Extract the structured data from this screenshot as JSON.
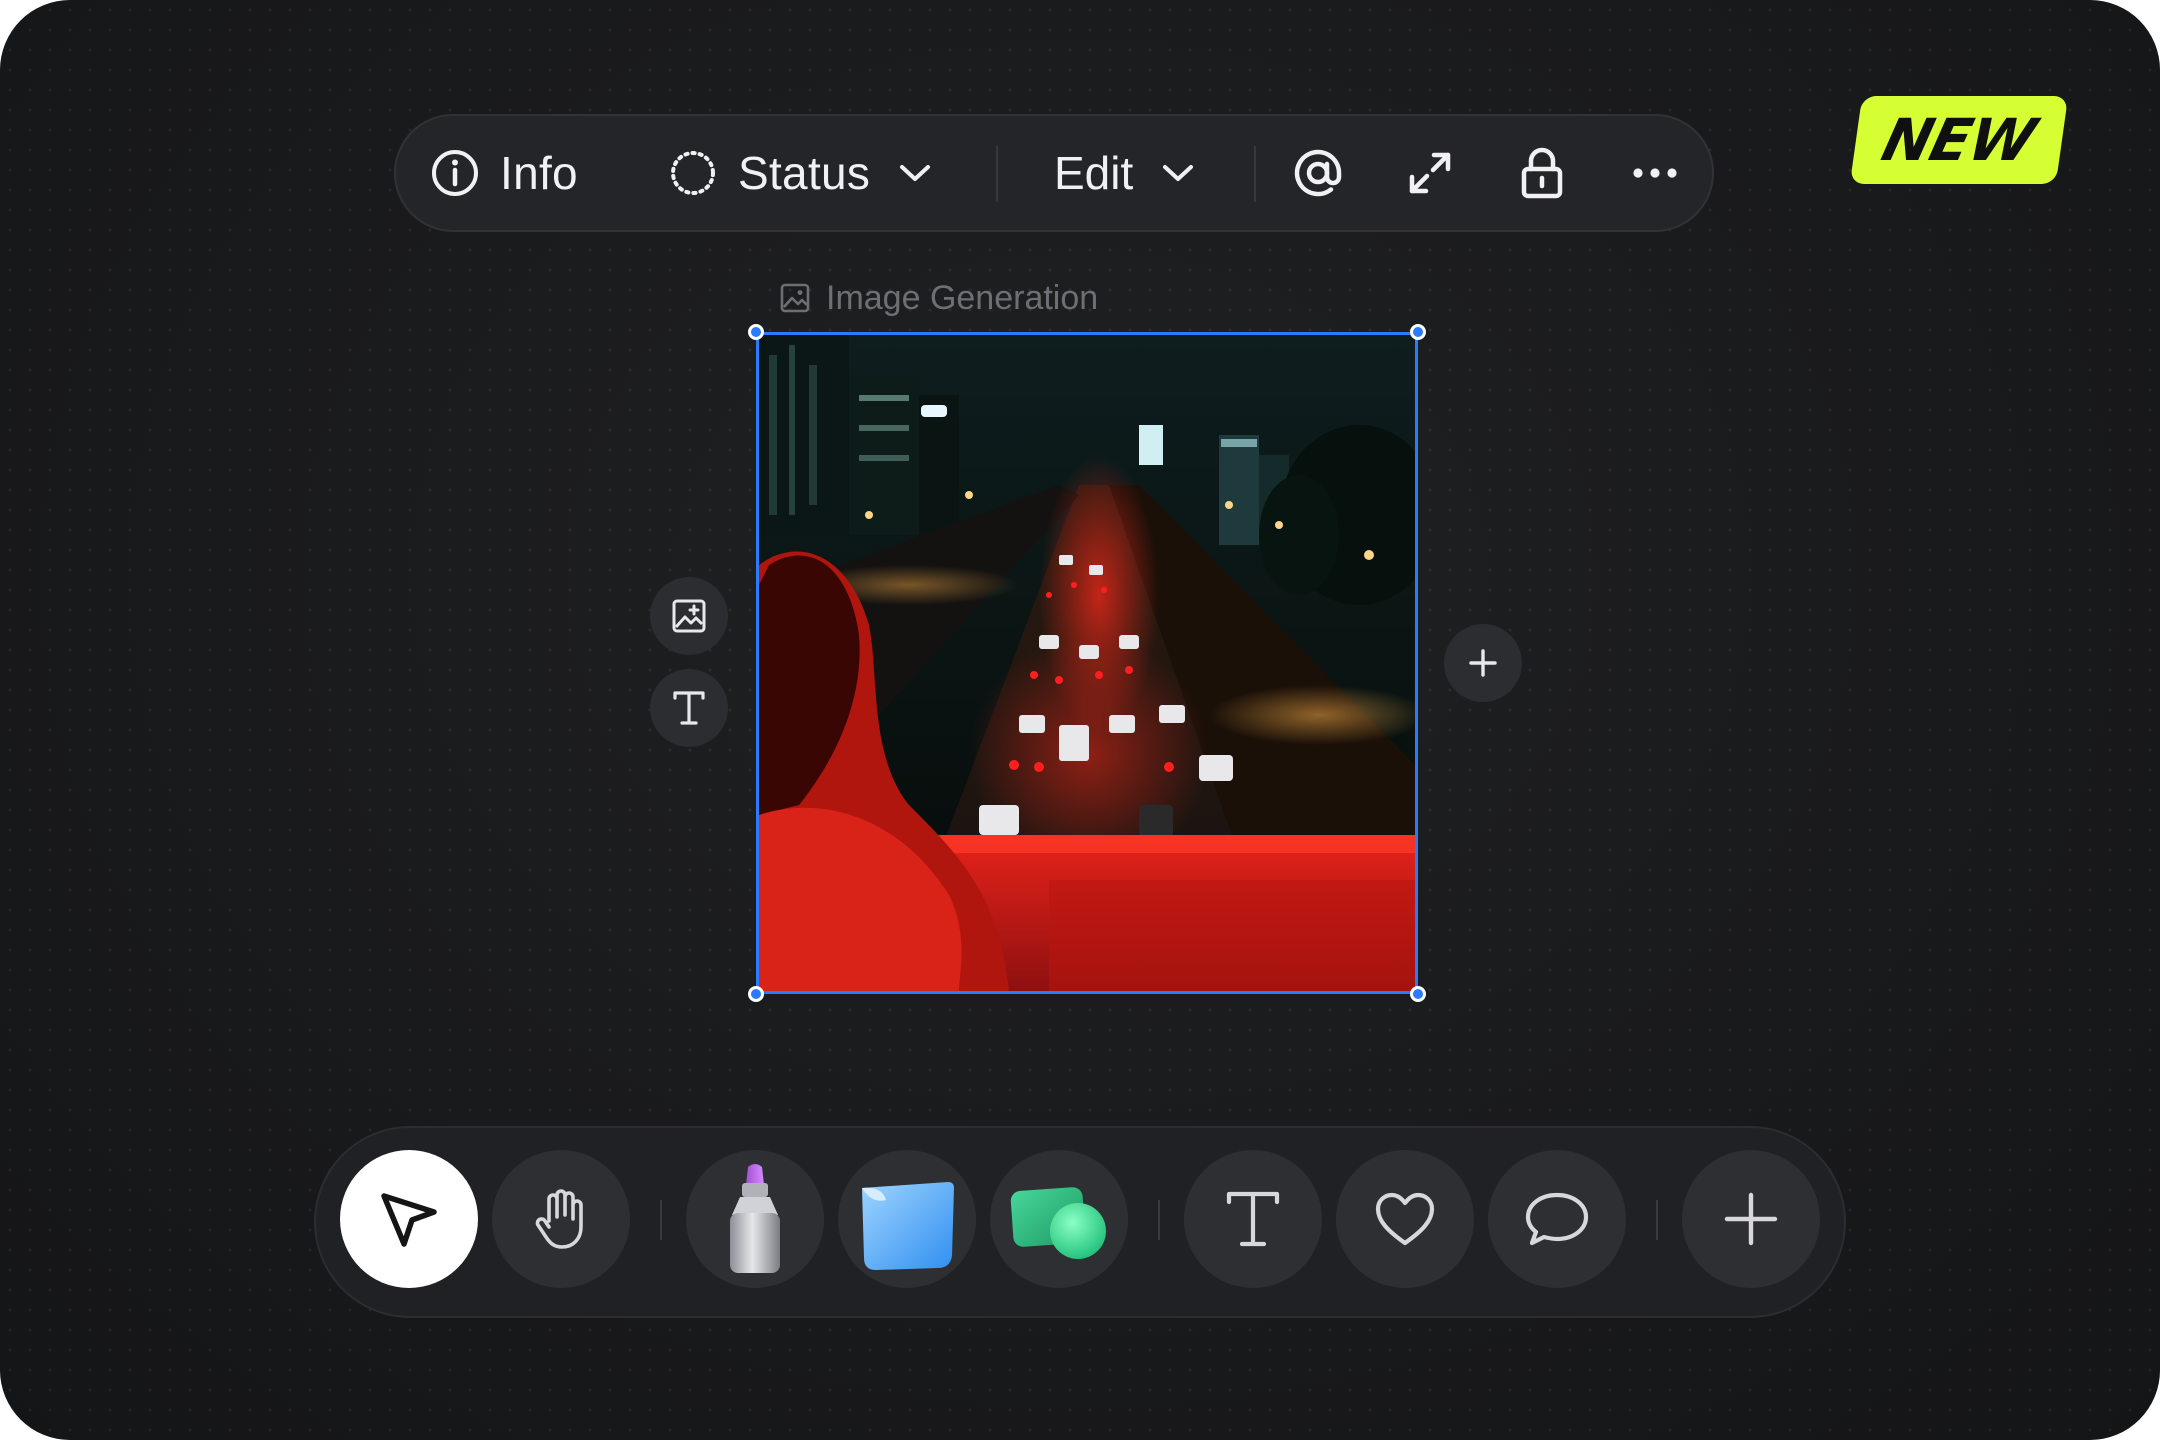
{
  "toolbar": {
    "info_label": "Info",
    "status_label": "Status",
    "edit_label": "Edit",
    "icons": [
      "info-icon",
      "status-ring-icon",
      "chevron-down-icon",
      "at-sign-icon",
      "expand-icon",
      "lock-icon",
      "more-icon"
    ]
  },
  "badge": {
    "label": "NEW",
    "color": "#d6ff33"
  },
  "frame": {
    "label": "Image Generation",
    "selection_color": "#2a7bff",
    "image_description_icon": "image-icon"
  },
  "side_tools": {
    "left": [
      "add-image-icon",
      "text-icon"
    ],
    "right": [
      "plus-icon"
    ]
  },
  "dock": {
    "tools": [
      "select-cursor-icon",
      "hand-icon",
      "marker-icon",
      "sticky-note-icon",
      "shape-icon",
      "text-icon",
      "heart-icon",
      "comment-icon",
      "plus-icon"
    ],
    "active_tool": "select-cursor-icon"
  }
}
